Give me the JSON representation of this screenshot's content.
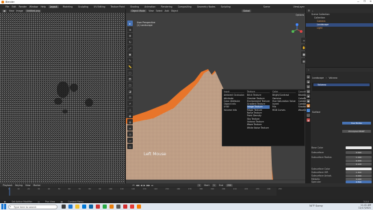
{
  "window": {
    "title": "Blender",
    "controls": [
      "—",
      "❐",
      "✕"
    ]
  },
  "menubar": {
    "menus": [
      "File",
      "Edit",
      "Render",
      "Window",
      "Help"
    ],
    "workspaces": [
      "Layout",
      "Modeling",
      "Sculpting",
      "UV Editing",
      "Texture Paint",
      "Shading",
      "Animation",
      "Rendering",
      "Compositing",
      "Geometry Nodes",
      "Scripting"
    ],
    "active_workspace": "Layout",
    "scene_label": "Scene",
    "view_layer_label": "ViewLayer"
  },
  "image_editor": {
    "view_label": "View",
    "image_label": "Image",
    "image_name": "Untitled.png"
  },
  "viewport": {
    "mode": "Object Mode",
    "menus": [
      "View",
      "Select",
      "Add",
      "Object"
    ],
    "orientation": "Global",
    "options_label": "Options",
    "overlay_line1": "User Perspective",
    "overlay_line2": "(1) Landscape",
    "keystroke_label": "Left Mouse"
  },
  "add_menu": {
    "columns": [
      {
        "header": "Input",
        "items": [
          "Ambient Occlusion",
          "Attribute",
          "Color Attribute",
          "Object Info",
          "UVW",
          "Volume Info"
        ]
      },
      {
        "header": "Texture",
        "items": [
          "Brick Texture",
          "Checker Texture",
          "Environment Texture",
          "Gradient Texture",
          "Image Texture",
          "Magic Texture",
          "Noise Texture",
          "Point Density",
          "Sky Texture",
          "Voronoi Texture",
          "Wave Texture",
          "White Noise Texture"
        ],
        "highlighted": "Image Texture"
      },
      {
        "header": "Color",
        "items": [
          "Bright/Contrast",
          "Gamma",
          "Hue Saturation Value",
          "Invert",
          "Mix",
          "RGB Curves"
        ]
      },
      {
        "header": "Converter",
        "items": [
          "Blackbody",
          "ColorRamp",
          "Combine HSV",
          "Combine RGB",
          "Shader to RGB",
          "Wavelength"
        ]
      }
    ]
  },
  "outliner": {
    "title": "Scene Collection",
    "items": [
      "Collection",
      "Camera",
      "Landscape",
      "Light"
    ]
  },
  "properties": {
    "object_name": "Landscape",
    "material_name": "Volcano",
    "material_slot": "Volcano",
    "surface_label": "Surface",
    "use_nodes_label": "Use Nodes",
    "shader_label": "Principled BSDF",
    "rows": [
      {
        "label": "Base Color",
        "value": ""
      },
      {
        "label": "Subsurface",
        "value": "0.000"
      },
      {
        "label": "Subsurface Radius",
        "value": "1.000"
      },
      {
        "label": "",
        "value": "0.200"
      },
      {
        "label": "",
        "value": "0.100"
      },
      {
        "label": "Subsurface Color",
        "value": ""
      },
      {
        "label": "Subsurface IOR",
        "value": "1.400"
      },
      {
        "label": "Subsurface Anisot.",
        "value": "0.000"
      },
      {
        "label": "Metallic",
        "value": "0.000"
      },
      {
        "label": "Specular",
        "value": "0.500"
      },
      {
        "label": "Specular Tint",
        "value": "0.000"
      }
    ]
  },
  "timeline": {
    "menus": [
      "Playback",
      "Keying",
      "View",
      "Marker"
    ],
    "current_frame": "1",
    "start_label": "Start",
    "start_value": "1",
    "end_label": "End",
    "end_value": "250",
    "ticks": [
      "0",
      "10",
      "20",
      "30",
      "40",
      "50",
      "60",
      "70",
      "80",
      "90",
      "100",
      "110",
      "120",
      "130",
      "140",
      "150",
      "160",
      "170",
      "180",
      "190",
      "200",
      "210",
      "220",
      "230",
      "240",
      "250"
    ]
  },
  "statusbar": {
    "items": [
      "Set Active Modifier",
      "Pan View",
      "Context Menu"
    ],
    "version": "3.0.0"
  },
  "taskbar": {
    "search_placeholder": "Type here to search",
    "weather": "54°F Sunny",
    "time": "11:41 AM",
    "date": "11/17/2021"
  },
  "colors": {
    "accent": "#4772b3",
    "terrain": "#e8752a",
    "active_item": "#334d80"
  }
}
